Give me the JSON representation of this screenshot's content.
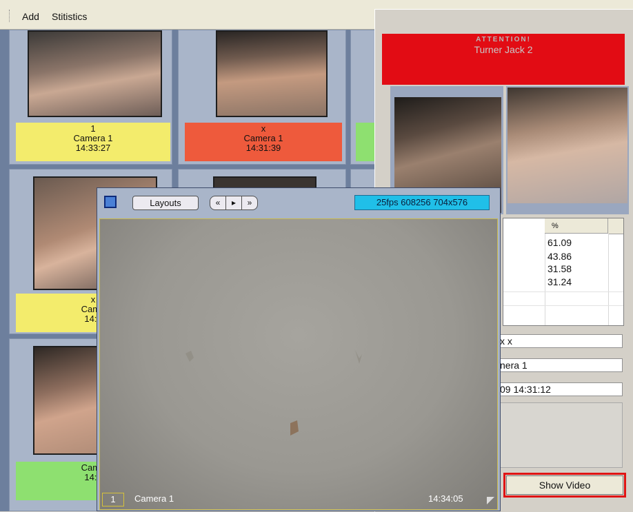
{
  "menu": {
    "add": "Add",
    "statistics": "Stitistics"
  },
  "tiles": [
    {
      "line1": "1",
      "line2": "Camera 1",
      "line3": "14:33:27",
      "color": "#f3ec6c"
    },
    {
      "line1": "x",
      "line2": "Camera 1",
      "line3": "14:31:39",
      "color": "#ee5a3c"
    },
    {
      "line1": "x",
      "line2": "Came",
      "line3": "14:3",
      "color": "#f3ec6c"
    },
    {
      "line1": "",
      "line2": "Came",
      "line3": "14:3",
      "color": "#8ee070"
    }
  ],
  "alert": {
    "attention": "ATTENTION!",
    "name": "Turner Jack 2",
    "results_header": "%",
    "scores": [
      "61.09",
      "43.86",
      "31.58",
      "31.24"
    ],
    "field_name": "x x",
    "field_camera": "nera 1",
    "field_datetime": "09 14:31:12",
    "show_video_label": "Show Video"
  },
  "video_window": {
    "layouts_label": "Layouts",
    "nav_prev": "«",
    "nav_play": "▸",
    "nav_next": "»",
    "stream_info": "25fps 608256 704x576",
    "camera_number": "1",
    "camera_name": "Camera 1",
    "timestamp": "14:34:05"
  },
  "colors": {
    "alert_red": "#e20c14",
    "stream_badge": "#20bfe8",
    "highlight_border": "#e01414"
  }
}
